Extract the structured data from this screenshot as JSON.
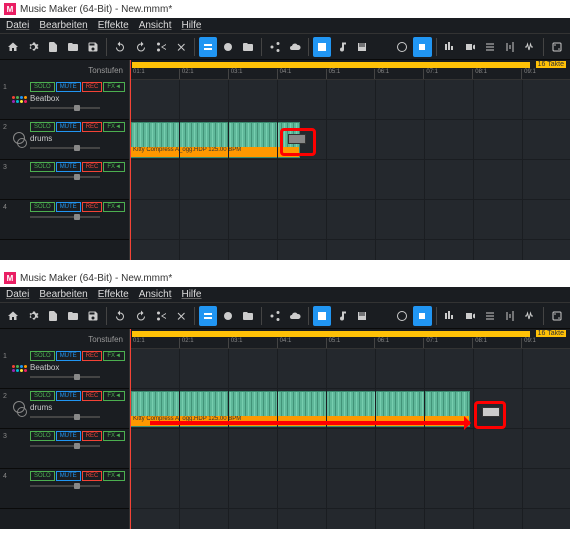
{
  "title": "Music Maker (64-Bit) - New.mmm*",
  "menus": [
    "Datei",
    "Bearbeiten",
    "Effekte",
    "Ansicht",
    "Hilfe"
  ],
  "ruler": {
    "label": "16 Takte",
    "ticks": [
      "01:1",
      "02:1",
      "03:1",
      "04:1",
      "05:1",
      "06:1",
      "07:1",
      "08:1",
      "09:1"
    ]
  },
  "track_header": "Tonstufen",
  "tracks": [
    {
      "num": "1",
      "name": "Beatbox"
    },
    {
      "num": "2",
      "name": "drums"
    },
    {
      "num": "3",
      "name": ""
    },
    {
      "num": "4",
      "name": ""
    }
  ],
  "btns": {
    "solo": "SOLO",
    "mute": "MUTE",
    "rec": "REC",
    "fx": "FX◄"
  },
  "clip": {
    "label": "Kitty Compress A_ogg.HDP  125.00 BPM"
  }
}
